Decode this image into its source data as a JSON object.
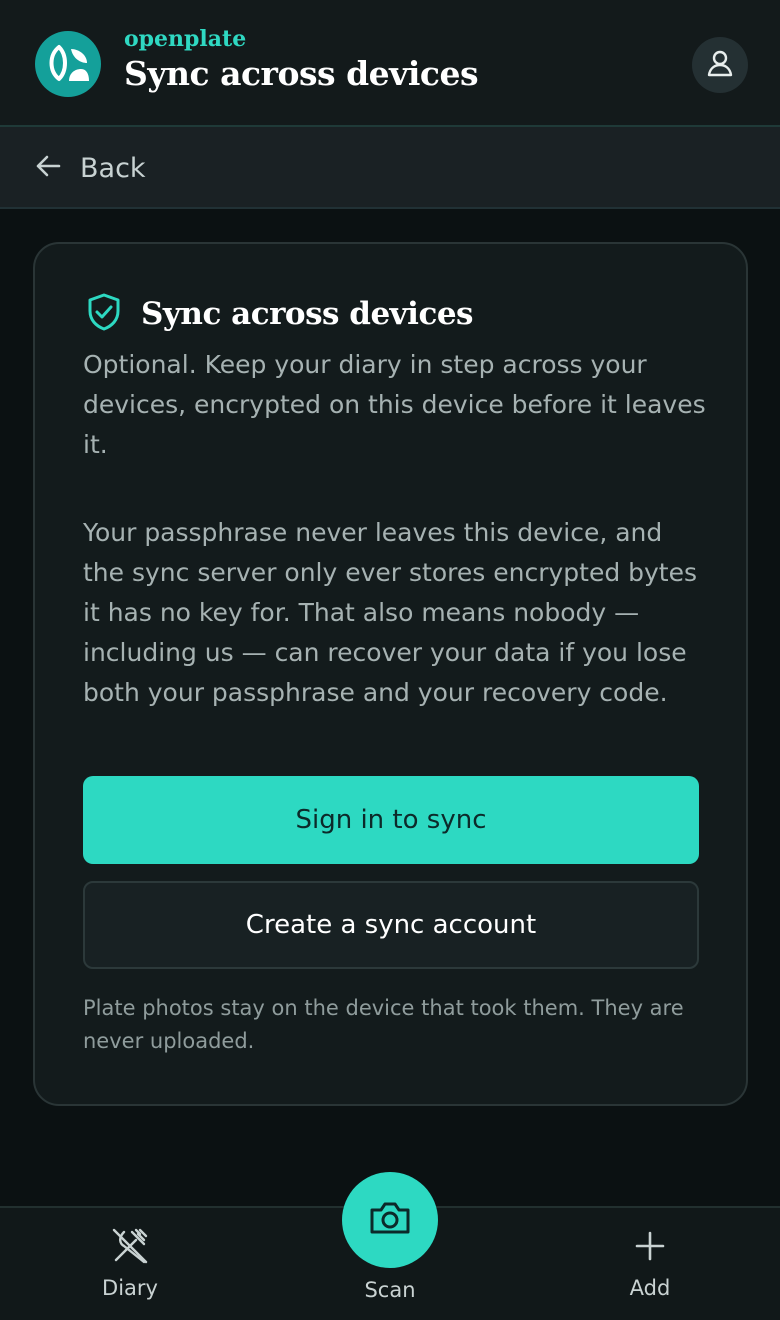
{
  "header": {
    "brand": "openplate",
    "title": "Sync across devices",
    "logo_icon": "leaf-logo-icon",
    "profile_icon": "user-icon"
  },
  "backbar": {
    "label": "Back",
    "icon": "arrow-left-icon"
  },
  "card": {
    "icon": "shield-check-icon",
    "title": "Sync across devices",
    "intro": "Optional. Keep your diary in step across your devices, encrypted on this device before it leaves it.",
    "details": "Your passphrase never leaves this device, and the sync server only ever stores encrypted bytes it has no key for. That also means nobody — including us — can recover your data if you lose both your passphrase and your recovery code.",
    "primary_button": "Sign in to sync",
    "secondary_button": "Create a sync account",
    "note": "Plate photos stay on the device that took them. They are never uploaded."
  },
  "nav": {
    "diary": "Diary",
    "scan": "Scan",
    "add": "Add"
  },
  "colors": {
    "accent": "#2dd9c2",
    "background": "#0b1112",
    "card": "#131b1c"
  }
}
